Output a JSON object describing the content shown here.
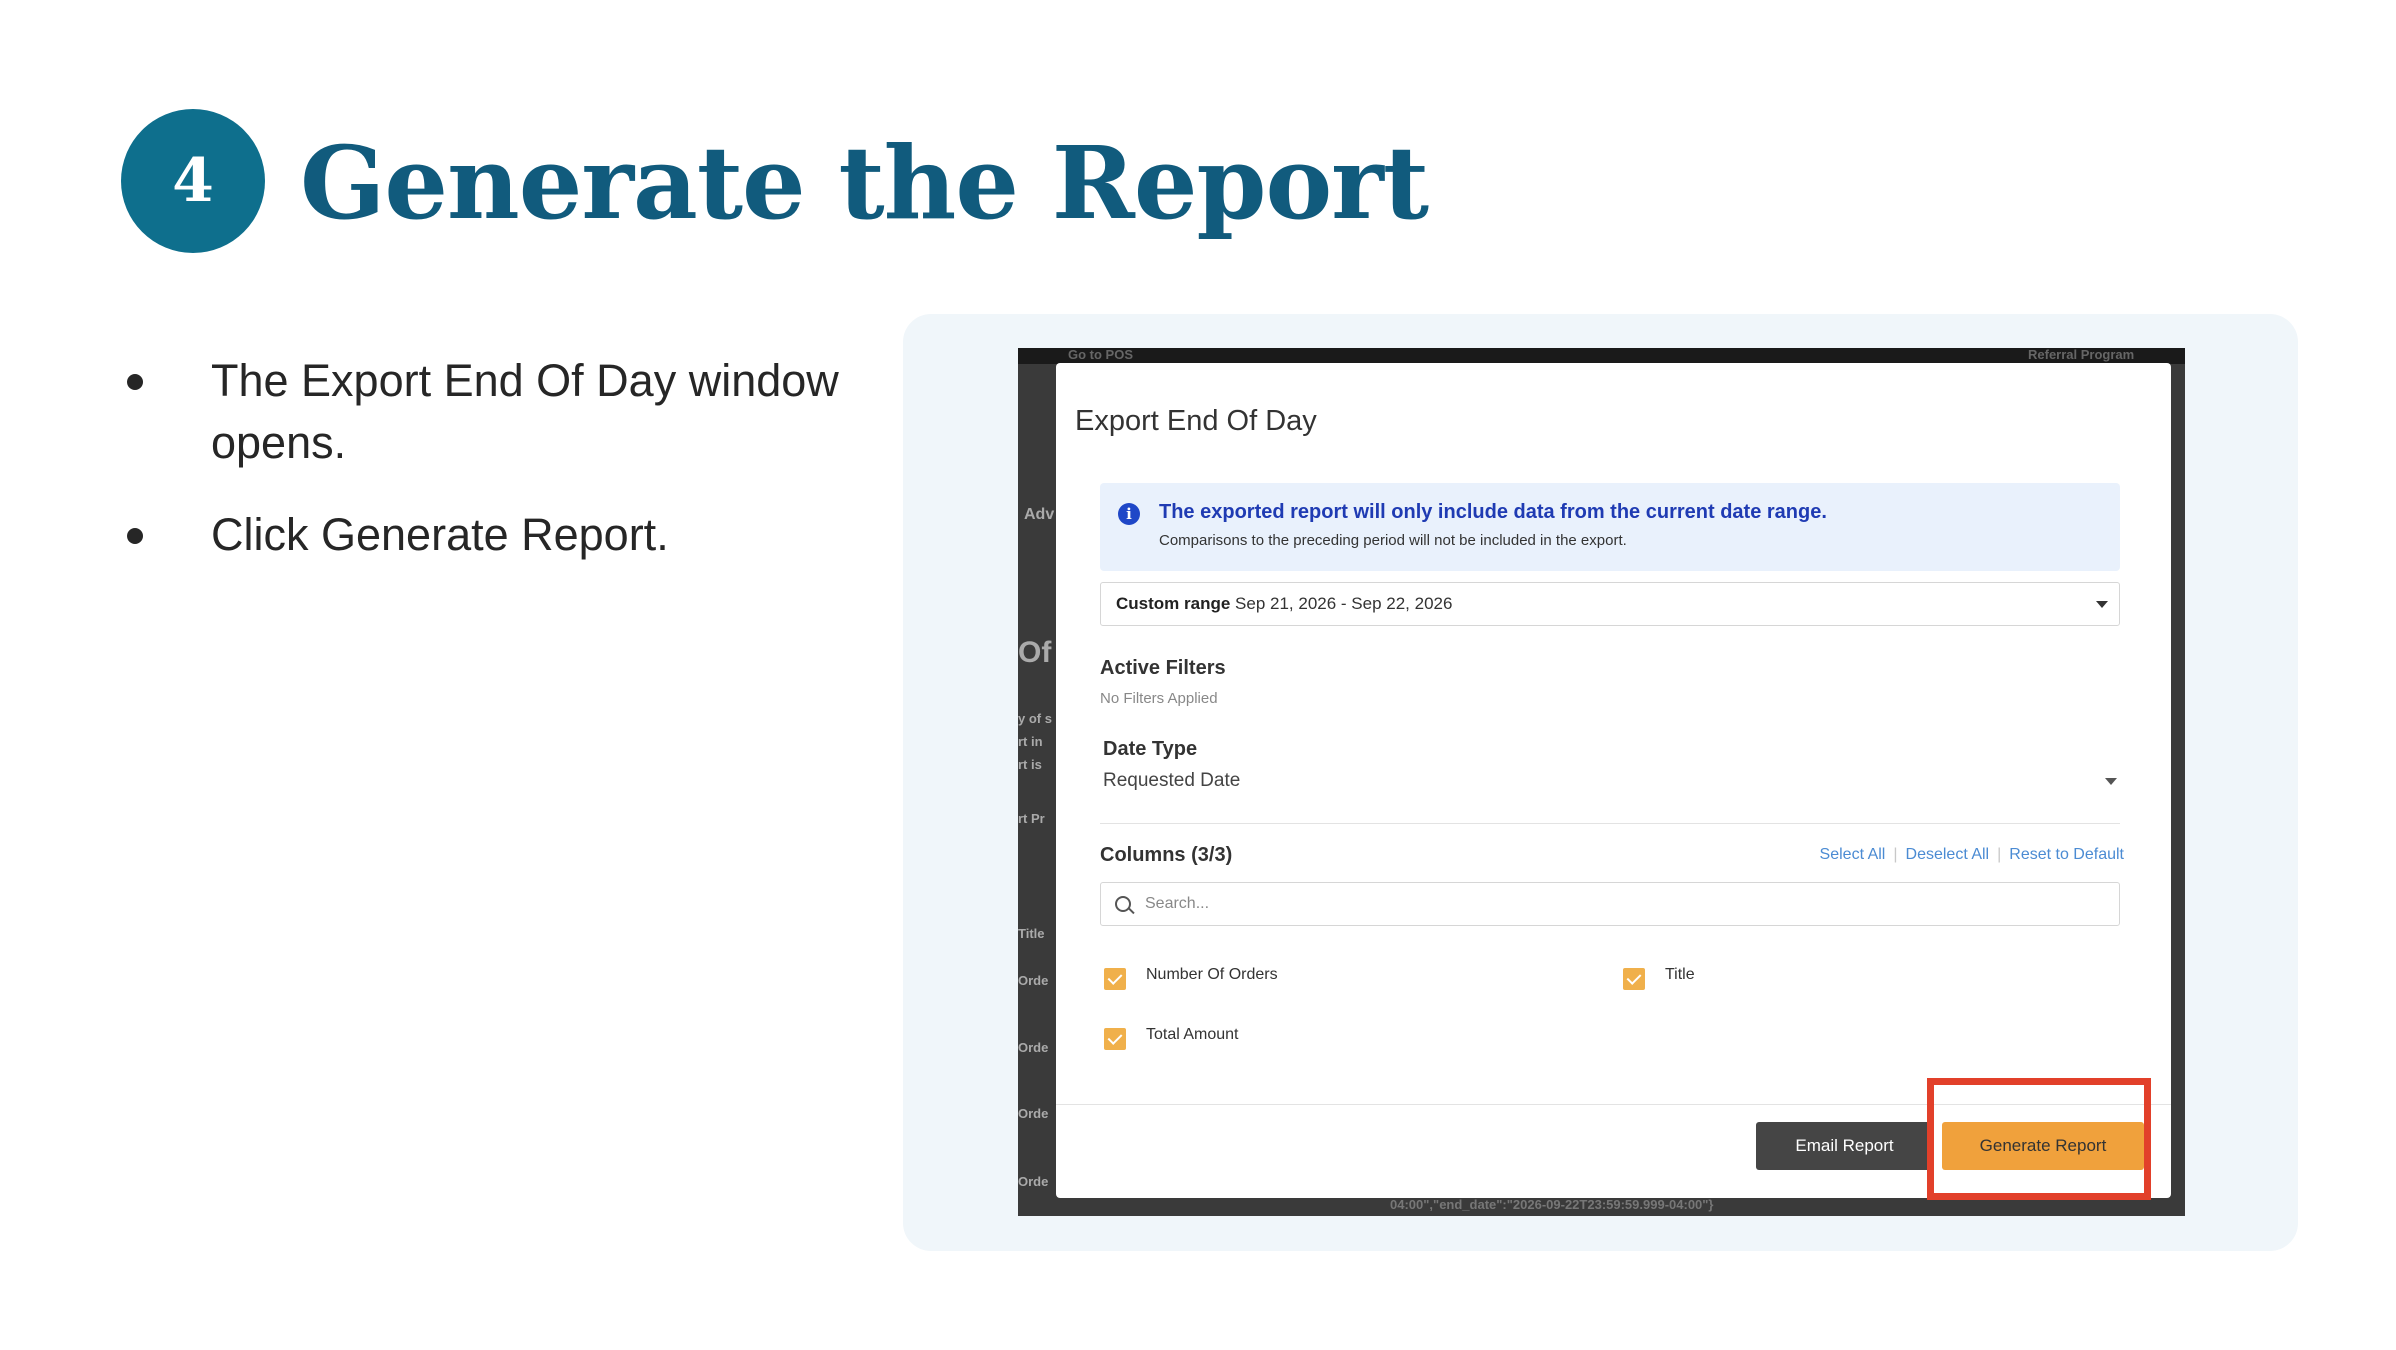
{
  "slide": {
    "step_number": "4",
    "title": "Generate the Report",
    "bullets": [
      "The Export End Of Day window opens.",
      "Click Generate Report."
    ]
  },
  "background_fragments": {
    "top_left": "Go to POS",
    "top_right": "Referral Program",
    "side_1": "Adv",
    "side_2": "Of",
    "side_3": "y of s",
    "side_4": "rt in",
    "side_5": "rt is",
    "side_6": "rt Pr",
    "side_7": "Title",
    "side_8": "Orde",
    "side_9": "Orde",
    "side_10": "Orde",
    "side_11": "Orde",
    "bottom": "04:00\",\"end_date\":\"2026-09-22T23:59:59.999-04:00\"}"
  },
  "modal": {
    "title": "Export End Of Day",
    "info": {
      "icon": "info-icon",
      "main": "The exported report will only include data from the current date range.",
      "sub": "Comparisons to the preceding period will not be included in the export."
    },
    "range": {
      "label": "Custom range",
      "value": "Sep 21, 2026 - Sep 22, 2026"
    },
    "active_filters": {
      "label": "Active Filters",
      "value": "No Filters Applied"
    },
    "date_type": {
      "label": "Date Type",
      "value": "Requested Date"
    },
    "columns": {
      "label": "Columns (3/3)",
      "select_all": "Select All",
      "deselect_all": "Deselect All",
      "reset_default": "Reset to Default",
      "search_placeholder": "Search...",
      "items": [
        {
          "label": "Number Of Orders",
          "checked": true
        },
        {
          "label": "Title",
          "checked": true
        },
        {
          "label": "Total Amount",
          "checked": true
        }
      ]
    },
    "buttons": {
      "email": "Email Report",
      "generate": "Generate Report"
    }
  },
  "colors": {
    "title": "#115b7d",
    "step_circle": "#0e6f8d",
    "generate_button": "#f0a13c",
    "highlight": "#e2402a",
    "checkbox": "#f0b04b"
  }
}
